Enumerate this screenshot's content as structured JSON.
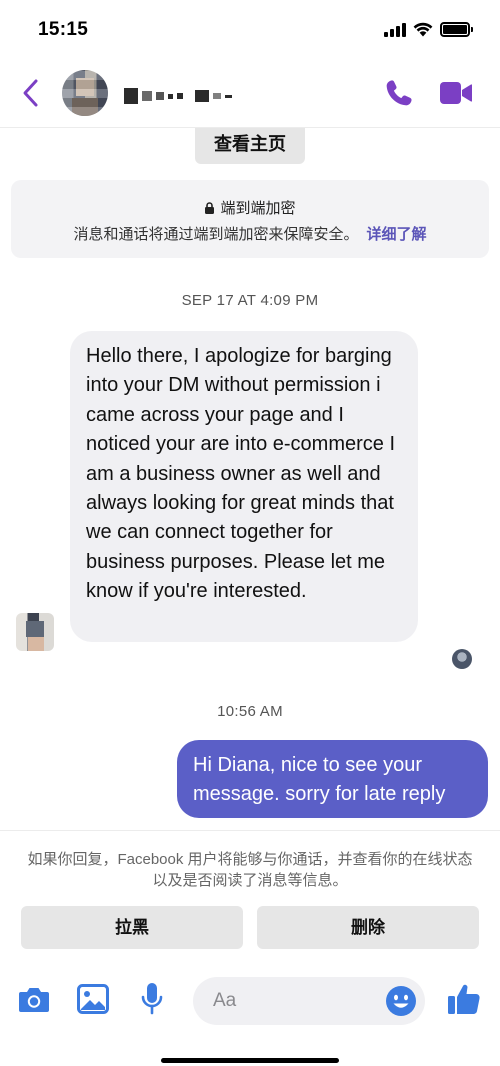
{
  "status_bar": {
    "time": "15:15",
    "icons": [
      "signal-icon",
      "wifi-icon",
      "battery-icon"
    ]
  },
  "header": {
    "contact_name": "",
    "accent_color": "#7b3fc4",
    "icons": [
      "back-icon",
      "phone-icon",
      "video-icon"
    ]
  },
  "profile_button": {
    "label": "查看主页"
  },
  "encryption": {
    "title": "端到端加密",
    "description": "消息和通话将通过端到端加密来保障安全。",
    "learn_more": "详细了解"
  },
  "messages": [
    {
      "timestamp": "SEP 17 AT 4:09 PM",
      "direction": "incoming",
      "text": "Hello there, I apologize for barging into your DM without permission i came across your page and I noticed your are into e-commerce I am a business owner as well and always looking for great minds that we can connect together for business purposes. Please let me know if you're interested."
    },
    {
      "timestamp": "10:56 AM",
      "direction": "outgoing",
      "text": "Hi Diana, nice to see your message.  sorry for late reply",
      "bubble_color": "#5b5fc7"
    }
  ],
  "message_request": {
    "notice": "如果你回复，Facebook 用户将能够与你通话，并查看你的在线状态以及是否阅读了消息等信息。",
    "block_label": "拉黑",
    "delete_label": "删除"
  },
  "composer": {
    "placeholder": "Aa",
    "icon_color": "#3b7be0",
    "icons": [
      "camera-icon",
      "image-icon",
      "mic-icon",
      "emoji-icon",
      "thumbs-up-icon"
    ]
  }
}
